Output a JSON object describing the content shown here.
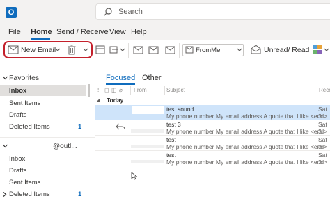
{
  "app": {
    "logo_letter": "O"
  },
  "search": {
    "placeholder": "Search"
  },
  "menu": {
    "tabs": [
      {
        "label": "File"
      },
      {
        "label": "Home"
      },
      {
        "label": "Send / Receive"
      },
      {
        "label": "View"
      },
      {
        "label": "Help"
      }
    ],
    "active": "Home"
  },
  "ribbon": {
    "new_email": "New Email",
    "from_me": "FromMe",
    "unread_read": "Unread/ Read"
  },
  "nav": {
    "favorites_label": "Favorites",
    "favorites": [
      {
        "label": "Inbox",
        "count": ""
      },
      {
        "label": "Sent Items",
        "count": ""
      },
      {
        "label": "Drafts",
        "count": ""
      },
      {
        "label": "Deleted Items",
        "count": "1"
      }
    ],
    "account_label": "@outl...",
    "account_items": [
      {
        "label": "Inbox",
        "count": ""
      },
      {
        "label": "Drafts",
        "count": ""
      },
      {
        "label": "Sent Items",
        "count": ""
      },
      {
        "label": "Deleted Items",
        "count": "1"
      }
    ]
  },
  "list": {
    "tab_focused": "Focused",
    "tab_other": "Other",
    "col_from": "From",
    "col_subject": "Subject",
    "col_received": "Rece",
    "group_today": "Today",
    "rows": [
      {
        "subject": "test sound",
        "preview": "My phone number  My email address  A quote that I like <end>",
        "date": "Sat 3",
        "selected": true
      },
      {
        "subject": "test 3",
        "preview": "My phone number  My email address  A quote that I like <end>",
        "date": "Sat 3",
        "selected": false
      },
      {
        "subject": "test",
        "preview": "My phone number  My email address  A quote that I like <end>",
        "date": "Sat 3",
        "selected": false
      },
      {
        "subject": "test",
        "preview": "My phone number  My email address  A quote that I like <end>",
        "date": "Sat 3",
        "selected": false
      }
    ]
  },
  "colors": {
    "accent": "#0f6cbd",
    "highlight_outline": "#c4202b",
    "selected_row": "#cfe4fa"
  }
}
